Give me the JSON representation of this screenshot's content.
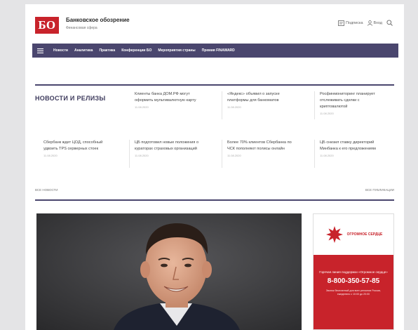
{
  "header": {
    "logo_text": "БО",
    "brand_title": "Банковское обозрение",
    "brand_subtitle": "Финансовая сфера",
    "subscribe_label": "Подписка",
    "login_label": "Вход"
  },
  "nav": {
    "items": [
      "Новости",
      "Аналитика",
      "Практика",
      "Конференции БО",
      "Мероприятия страны",
      "Премия FINAWARD"
    ]
  },
  "news": {
    "section_title": "НОВОСТИ И РЕЛИЗЫ",
    "items": [
      {
        "headline": "Клиенты банка ДОМ.РФ могут оформить мультивалютную карту",
        "date": "11.08.2020"
      },
      {
        "headline": "«Яндекс» объявил о запуске платформы для банкоматов",
        "date": "11.08.2020"
      },
      {
        "headline": "Росфинмониторинг планирует отслеживать сделки с криптовалютой",
        "date": "11.08.2020"
      },
      {
        "headline": "Сбербанк ждет ЦОД, способный удвоить TPS серверных стоек",
        "date": "11.08.2020"
      },
      {
        "headline": "ЦБ подготовил новые положения о кураторах страховых организаций",
        "date": "11.08.2020"
      },
      {
        "headline": "Более 70% клиентов Сбербанка по ЧСК пополняют полисы онлайн",
        "date": "11.08.2020"
      },
      {
        "headline": "ЦБ снизил ставку директорий Минбанка к его предложениям",
        "date": "11.08.2020"
      }
    ],
    "all_news_label": "ВСЕ НОВОСТИ",
    "all_publications_label": "ВСЕ ПУБЛИКАЦИИ"
  },
  "ad": {
    "brand": "ОГРОМНОЕ СЕРДЦЕ",
    "caption": "Горячая линия поддержки «Огромное сердце»",
    "phone": "8-800-350-57-85",
    "note": "Звонок бесплатный для всех регионов России, ежедневно с 10:00 до 20:00"
  },
  "colors": {
    "accent": "#c8232b",
    "nav_bg": "#4a466e",
    "section_title": "#3d3a5c"
  },
  "icons": [
    "logo-icon",
    "subscribe-icon",
    "login-icon",
    "search-icon",
    "menu-icon",
    "heart-icon"
  ]
}
